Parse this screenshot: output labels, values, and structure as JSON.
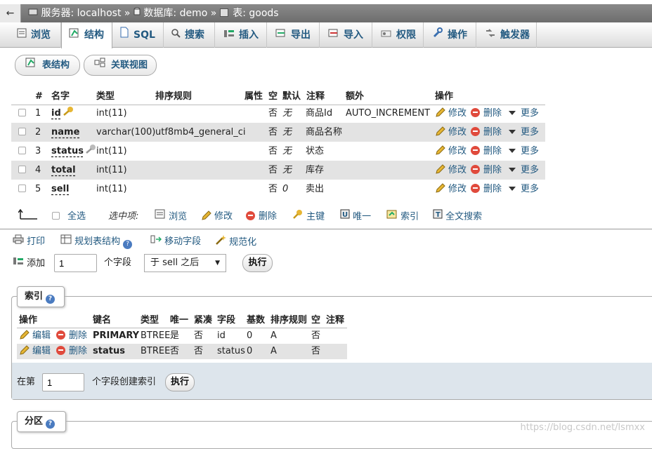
{
  "breadcrumb": {
    "back": "←",
    "server_label": "服务器: localhost",
    "sep1": "»",
    "database_label": "数据库: demo",
    "sep2": "»",
    "table_label": "表: goods"
  },
  "tabs": [
    {
      "label": "浏览",
      "icon": "browse-icon"
    },
    {
      "label": "结构",
      "icon": "structure-icon",
      "active": true
    },
    {
      "label": "SQL",
      "icon": "sql-icon"
    },
    {
      "label": "搜索",
      "icon": "search-icon"
    },
    {
      "label": "插入",
      "icon": "insert-icon"
    },
    {
      "label": "导出",
      "icon": "export-icon"
    },
    {
      "label": "导入",
      "icon": "import-icon"
    },
    {
      "label": "权限",
      "icon": "privileges-icon"
    },
    {
      "label": "操作",
      "icon": "operations-icon"
    },
    {
      "label": "触发器",
      "icon": "triggers-icon"
    }
  ],
  "subtabs": [
    {
      "label": "表结构",
      "icon": "table-structure-icon"
    },
    {
      "label": "关联视图",
      "icon": "relation-view-icon"
    }
  ],
  "structure": {
    "headers": [
      "#",
      "名字",
      "类型",
      "排序规则",
      "属性",
      "空",
      "默认",
      "注释",
      "额外",
      "操作"
    ],
    "rows": [
      {
        "num": "1",
        "name": "id",
        "key": "primary",
        "type": "int(11)",
        "collation": "",
        "attributes": "",
        "null": "否",
        "default": "无",
        "comment": "商品Id",
        "extra": "AUTO_INCREMENT"
      },
      {
        "num": "2",
        "name": "name",
        "key": "",
        "type": "varchar(100)",
        "collation": "utf8mb4_general_ci",
        "attributes": "",
        "null": "否",
        "default": "无",
        "comment": "商品名称",
        "extra": ""
      },
      {
        "num": "3",
        "name": "status",
        "key": "index",
        "type": "int(11)",
        "collation": "",
        "attributes": "",
        "null": "否",
        "default": "无",
        "comment": "状态",
        "extra": ""
      },
      {
        "num": "4",
        "name": "total",
        "key": "",
        "type": "int(11)",
        "collation": "",
        "attributes": "",
        "null": "否",
        "default": "无",
        "comment": "库存",
        "extra": ""
      },
      {
        "num": "5",
        "name": "sell",
        "key": "",
        "type": "int(11)",
        "collation": "",
        "attributes": "",
        "null": "否",
        "default": "0",
        "comment": "卖出",
        "extra": ""
      }
    ],
    "actions": {
      "change": "修改",
      "drop": "删除",
      "more": "更多"
    }
  },
  "bulk": {
    "check_all": "全选",
    "with_selected": "选中项:",
    "browse": "浏览",
    "change": "修改",
    "drop": "删除",
    "primary": "主键",
    "unique": "唯一",
    "index": "索引",
    "fulltext": "全文搜索"
  },
  "tools": {
    "print": "打印",
    "propose": "规划表结构",
    "move": "移动字段",
    "normalize": "规范化"
  },
  "add_column": {
    "label": "添加",
    "count": "1",
    "unit": "个字段",
    "position": "于 sell 之后",
    "go": "执行"
  },
  "indexes": {
    "legend": "索引",
    "headers": [
      "操作",
      "键名",
      "类型",
      "唯一",
      "紧凑",
      "字段",
      "基数",
      "排序规则",
      "空",
      "注释"
    ],
    "rows": [
      {
        "edit": "编辑",
        "drop": "删除",
        "keyname": "PRIMARY",
        "type": "BTREE",
        "unique": "是",
        "packed": "否",
        "column": "id",
        "cardinality": "0",
        "collation": "A",
        "null": "否",
        "comment": ""
      },
      {
        "edit": "编辑",
        "drop": "删除",
        "keyname": "status",
        "type": "BTREE",
        "unique": "否",
        "packed": "否",
        "column": "status",
        "cardinality": "0",
        "collation": "A",
        "null": "否",
        "comment": ""
      }
    ],
    "create_prefix": "在第",
    "create_count": "1",
    "create_suffix": "个字段创建索引",
    "go": "执行"
  },
  "partitions": {
    "legend": "分区"
  },
  "watermark": "https://blog.csdn.net/lsmxx"
}
